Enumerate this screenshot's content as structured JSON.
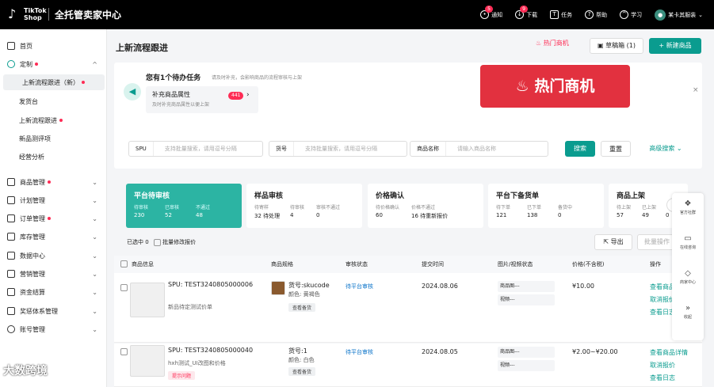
{
  "topbar": {
    "logo_text": "TikTok Shop",
    "app_title": "全托管卖家中心",
    "nav": [
      {
        "label": "通知",
        "icon": "bell-icon",
        "badge": "5"
      },
      {
        "label": "下载",
        "icon": "download-icon",
        "badge": "9"
      },
      {
        "label": "任务",
        "icon": "trophy-icon",
        "badge": ""
      },
      {
        "label": "帮助",
        "icon": "help-icon",
        "badge": ""
      },
      {
        "label": "学习",
        "icon": "graduation-icon",
        "badge": ""
      }
    ],
    "user_name": "某卡其服装"
  },
  "sidebar": {
    "items": [
      {
        "label": "首页",
        "icon": "home-icon",
        "dot": false,
        "chevron": ""
      },
      {
        "label": "定制",
        "icon": "location-icon",
        "dot": true,
        "chevron": "^"
      },
      {
        "label": "上新流程跟进（新）",
        "sub": true,
        "active": true,
        "dot": true
      },
      {
        "label": "发货台",
        "sub": true
      },
      {
        "label": "上新流程跟进",
        "sub": true,
        "dot": true
      },
      {
        "label": "新品测评项",
        "sub": true
      },
      {
        "label": "经营分析",
        "sub": true
      },
      {
        "label": "商品管理",
        "icon": "box-icon",
        "dot": true,
        "chevron": "v"
      },
      {
        "label": "计划管理",
        "icon": "calendar-icon",
        "dot": false,
        "chevron": "v"
      },
      {
        "label": "订单管理",
        "icon": "order-icon",
        "dot": true,
        "chevron": "v"
      },
      {
        "label": "库存管理",
        "icon": "warehouse-icon",
        "dot": false,
        "chevron": "v"
      },
      {
        "label": "数据中心",
        "icon": "chart-icon",
        "dot": false,
        "chevron": "v"
      },
      {
        "label": "营销管理",
        "icon": "megaphone-icon",
        "dot": false,
        "chevron": "v"
      },
      {
        "label": "资金结算",
        "icon": "wallet-icon",
        "dot": false,
        "chevron": "v"
      },
      {
        "label": "奖惩体系管理",
        "icon": "shield-icon",
        "dot": false,
        "chevron": "v"
      },
      {
        "label": "账号管理",
        "icon": "user-icon",
        "dot": false,
        "chevron": "v"
      }
    ]
  },
  "header": {
    "title": "上新流程跟进",
    "hot_label": "热门商机",
    "draft_label": "草稿箱 (1)",
    "new_label": "+ 新建商品"
  },
  "todo": {
    "heading": "您有1个待办任务",
    "subheading": "请及时补充，会影响商品的流程审核与上架",
    "card_title": "补充商品属性",
    "card_sub": "及时补充商品属性以便上架",
    "card_badge": "441",
    "banner": "热门商机"
  },
  "filter": {
    "field1_key": "SPU",
    "field1_placeholder": "支持批量搜索，请用逗号分隔",
    "field2_key": "货号",
    "field2_placeholder": "支持批量搜索，请用逗号分隔",
    "field3_key": "商品名称",
    "field3_placeholder": "请输入商品名称",
    "search": "搜索",
    "reset": "重置",
    "advanced": "高级搜索"
  },
  "stats": [
    {
      "title": "平台待审核",
      "metrics": [
        {
          "k": "待审核",
          "v": "230"
        },
        {
          "k": "已审核",
          "v": "52"
        },
        {
          "k": "不通过",
          "v": "48"
        }
      ],
      "active": true
    },
    {
      "title": "样品审核",
      "metrics": [
        {
          "k": "待寄样",
          "v": "32 待处理"
        },
        {
          "k": "待审核",
          "v": "4"
        },
        {
          "k": "审核不通过",
          "v": "0"
        }
      ],
      "active": false
    },
    {
      "title": "价格确认",
      "metrics": [
        {
          "k": "待价格确认",
          "v": "60"
        },
        {
          "k": "价格不通过",
          "v": "16 待重新报价"
        }
      ],
      "active": false
    },
    {
      "title": "平台下备货单",
      "metrics": [
        {
          "k": "待下单",
          "v": "121"
        },
        {
          "k": "已下单",
          "v": "138"
        },
        {
          "k": "备货中",
          "v": "0"
        }
      ],
      "active": false
    },
    {
      "title": "商品上架",
      "metrics": [
        {
          "k": "待上架",
          "v": "57"
        },
        {
          "k": "已上架",
          "v": "49"
        },
        {
          "k": "",
          "v": "0"
        }
      ],
      "active": false
    }
  ],
  "toolbar": {
    "selected": "已选中 0",
    "batch_modify": "批量修改报价",
    "export": "导出",
    "batch_action": "批量操作"
  },
  "table": {
    "headers": [
      "商品信息",
      "商品规格",
      "审核状态",
      "提交时间",
      "图片/视频状态",
      "价格(不含税)",
      "操作"
    ],
    "rows": [
      {
        "spu": "SPU: TEST3240805000006",
        "name": "新品待定测试价单",
        "sku": "货号:skucode",
        "color": "颜色: 黄褐色",
        "spec_tag": "查看备货",
        "status": "待平台审核",
        "date": "2024.08.06",
        "img": "商品图---",
        "video": "视频---",
        "price": "¥10.00",
        "actions": [
          "查看商品详情",
          "取消报价",
          "查看日志"
        ],
        "name_tag": ""
      },
      {
        "spu": "SPU: TEST3240805000040",
        "name": "hxh测试_UI改图和价格",
        "sku": "货号:1",
        "color": "颜色: 白色",
        "spec_tag": "查看备货",
        "status": "待平台审核",
        "date": "2024.08.05",
        "img": "商品图---",
        "video": "视频---",
        "price": "¥2.00~¥20.00",
        "actions": [
          "查看商品详情",
          "取消报价",
          "查看日志"
        ],
        "name_tag": "提示问题"
      }
    ]
  },
  "right_panel": [
    {
      "label": "官方社群",
      "icon": "community-icon"
    },
    {
      "label": "在线咨询",
      "icon": "chat-icon"
    },
    {
      "label": "商家中心",
      "icon": "shield-icon"
    },
    {
      "label": "收起",
      "icon": "collapse-icon"
    }
  ],
  "watermark": "大数跨境"
}
